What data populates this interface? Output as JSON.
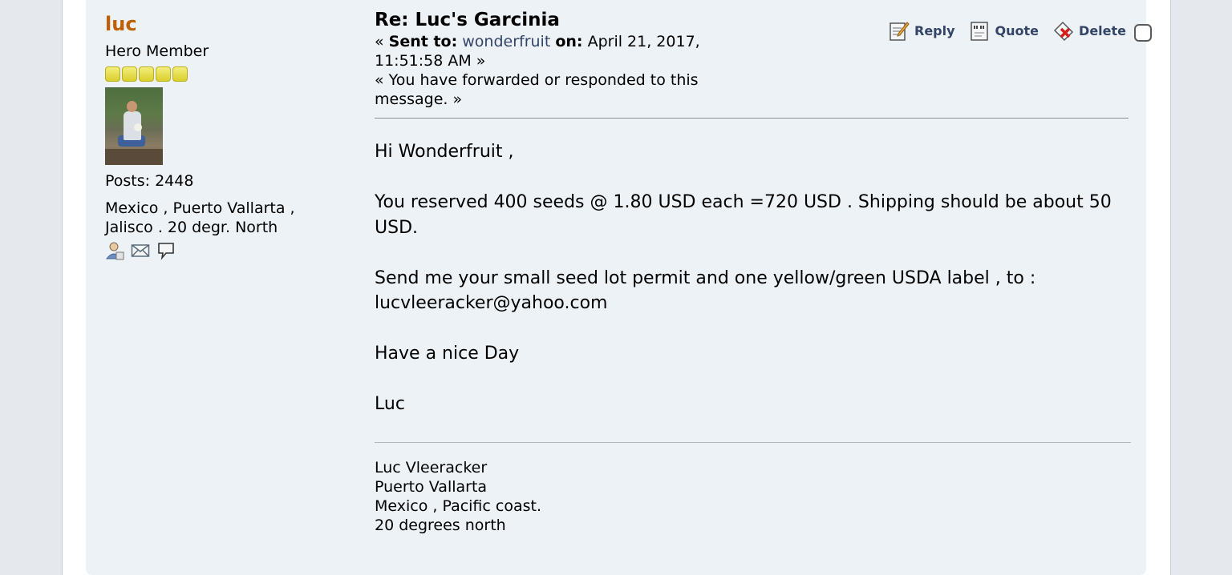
{
  "poster": {
    "name": "luc",
    "member_title": "Hero Member",
    "star_count": 5,
    "posts": "Posts: 2448",
    "location": "Mexico , Puerto Vallarta , Jalisco . 20 degr. North",
    "icons": [
      "profile-icon",
      "email-icon",
      "personal-message-icon"
    ]
  },
  "message": {
    "subject": "Re: Luc's Garcinia",
    "sent_prefix": "« ",
    "sent_to_label": "Sent to:",
    "recipient": "wonderfruit",
    "on_label": "on:",
    "date": "April 21, 2017, 11:51:58 AM »",
    "forwarded_note": "« You have forwarded or responded to this message. »",
    "body": [
      "Hi Wonderfruit ,",
      "You reserved 400 seeds @ 1.80 USD each =720 USD . Shipping should be about 50 USD.",
      "Send me your small seed lot permit and one yellow/green USDA label , to : lucvleeracker@yahoo.com",
      "Have a nice Day",
      "Luc"
    ],
    "signature": [
      "Luc Vleeracker",
      "Puerto Vallarta",
      "Mexico , Pacific coast.",
      "20 degrees north"
    ]
  },
  "actions": {
    "reply": "Reply",
    "quote": "Quote",
    "delete": "Delete"
  },
  "colors": {
    "poster_name": "#c06002",
    "action_text": "#334466",
    "post_background": "#edf2f6",
    "page_background": "#e5e9ee"
  }
}
